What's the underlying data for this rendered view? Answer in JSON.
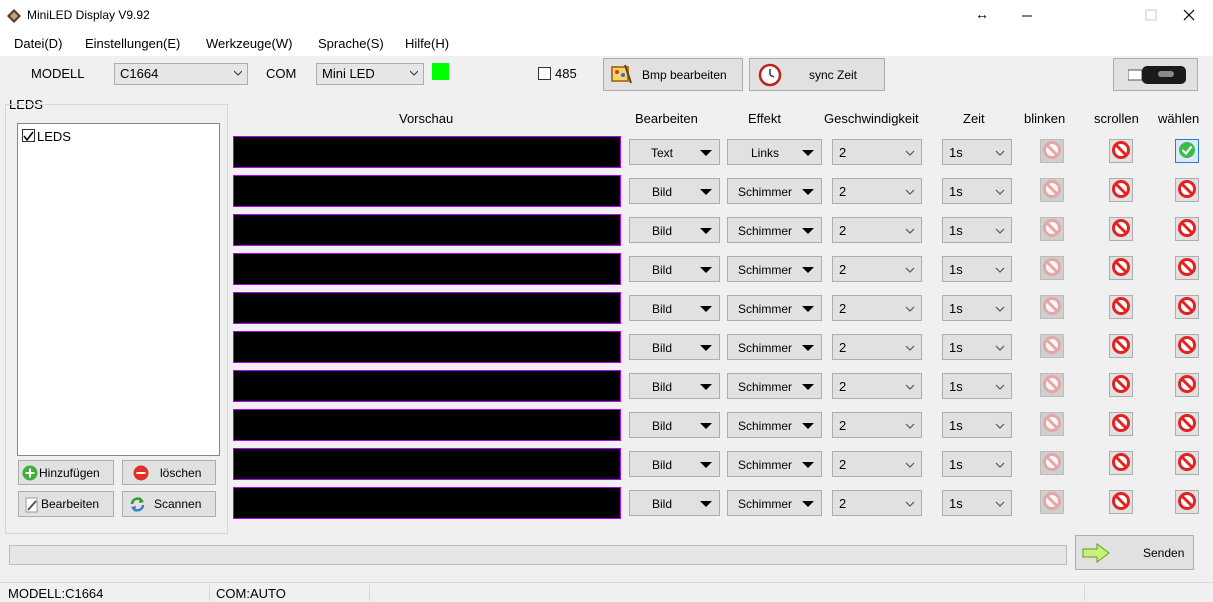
{
  "window": {
    "title": "MiniLED Display V9.92"
  },
  "menu": [
    "Datei(D)",
    "Einstellungen(E)",
    "Werkzeuge(W)",
    "Sprache(S)",
    "Hilfe(H)"
  ],
  "toolbar": {
    "modell_label": "MODELL",
    "modell_value": "C1664",
    "com_label": "COM",
    "com_value": "Mini LED",
    "rs485_label": "485",
    "bmp_button": "Bmp bearbeiten",
    "sync_button": "sync Zeit",
    "status_color": "#00ff00"
  },
  "leds_panel": {
    "group_label": "LEDS",
    "tree_item": "LEDS",
    "add_button": "Hinzufügen",
    "delete_button": "löschen",
    "edit_button": "Bearbeiten",
    "scan_button": "Scannen"
  },
  "headers": {
    "preview": "Vorschau",
    "edit": "Bearbeiten",
    "effect": "Effekt",
    "speed": "Geschwindigkeit",
    "time": "Zeit",
    "blink": "blinken",
    "scroll": "scrollen",
    "select": "wählen"
  },
  "rows": [
    {
      "edit": "Text",
      "effect": "Links",
      "speed": "2",
      "time": "1s",
      "selected": true
    },
    {
      "edit": "Bild",
      "effect": "Schimmer",
      "speed": "2",
      "time": "1s",
      "selected": false
    },
    {
      "edit": "Bild",
      "effect": "Schimmer",
      "speed": "2",
      "time": "1s",
      "selected": false
    },
    {
      "edit": "Bild",
      "effect": "Schimmer",
      "speed": "2",
      "time": "1s",
      "selected": false
    },
    {
      "edit": "Bild",
      "effect": "Schimmer",
      "speed": "2",
      "time": "1s",
      "selected": false
    },
    {
      "edit": "Bild",
      "effect": "Schimmer",
      "speed": "2",
      "time": "1s",
      "selected": false
    },
    {
      "edit": "Bild",
      "effect": "Schimmer",
      "speed": "2",
      "time": "1s",
      "selected": false
    },
    {
      "edit": "Bild",
      "effect": "Schimmer",
      "speed": "2",
      "time": "1s",
      "selected": false
    },
    {
      "edit": "Bild",
      "effect": "Schimmer",
      "speed": "2",
      "time": "1s",
      "selected": false
    },
    {
      "edit": "Bild",
      "effect": "Schimmer",
      "speed": "2",
      "time": "1s",
      "selected": false
    }
  ],
  "send_button": "Senden",
  "status": {
    "modell": "MODELL:C1664",
    "com": "COM:AUTO"
  }
}
